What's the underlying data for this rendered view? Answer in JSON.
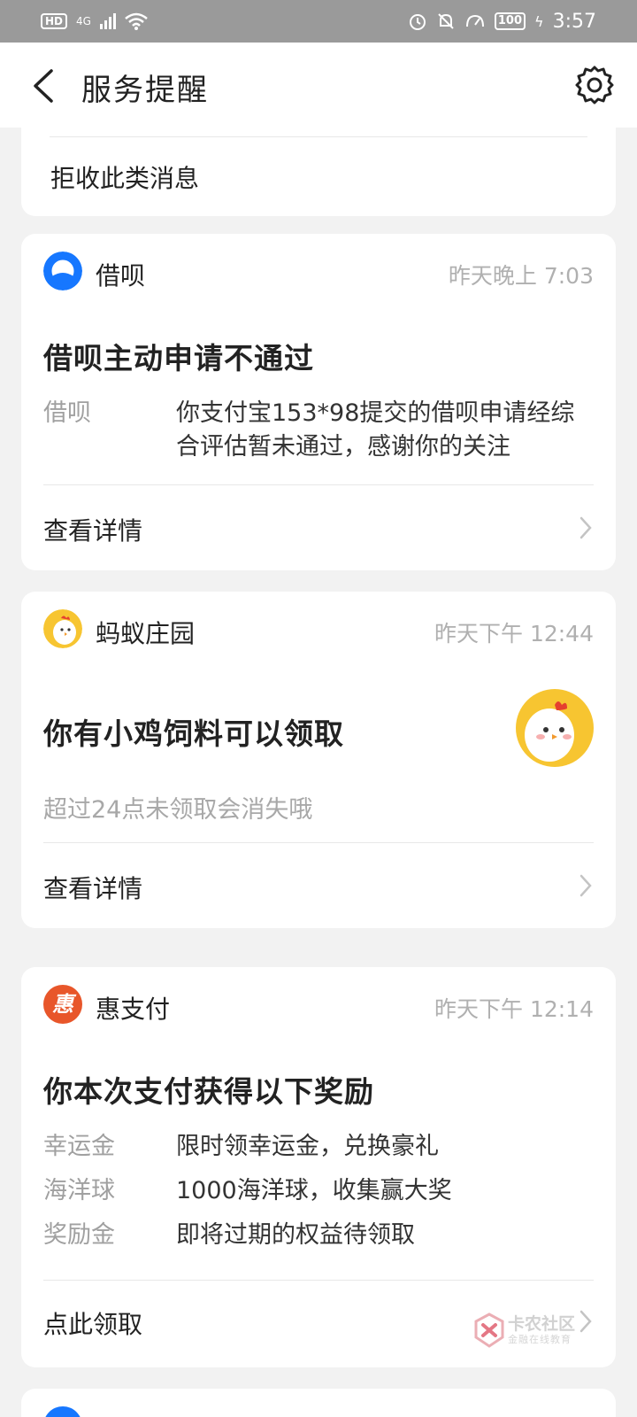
{
  "status_bar": {
    "hd_label": "HD",
    "network_label": "4G",
    "battery": "100",
    "time": "3:57"
  },
  "header": {
    "title": "服务提醒",
    "icons": {
      "back": "back-arrow-icon",
      "settings": "gear-icon"
    }
  },
  "top_card": {
    "reject_label": "拒收此类消息"
  },
  "messages": [
    {
      "app_name": "借呗",
      "icon": "jiebei-logo-icon",
      "time": "昨天晚上 7:03",
      "title": "借呗主动申请不通过",
      "rows": [
        {
          "key": "借呗",
          "value": "你支付宝153*98提交的借呗申请经综合评估暂未通过，感谢你的关注"
        }
      ],
      "action": "查看详情"
    },
    {
      "app_name": "蚂蚁庄园",
      "icon": "chicken-icon",
      "time": "昨天下午 12:44",
      "title": "你有小鸡饲料可以领取",
      "subtitle": "超过24点未领取会消失哦",
      "action": "查看详情"
    },
    {
      "app_name": "惠支付",
      "icon": "hui-logo-icon",
      "icon_text": "惠",
      "time": "昨天下午 12:14",
      "title": "你本次支付获得以下奖励",
      "rows": [
        {
          "key": "幸运金",
          "value": "限时领幸运金，兑换豪礼"
        },
        {
          "key": "海洋球",
          "value": "1000海洋球，收集赢大奖"
        },
        {
          "key": "奖励金",
          "value": "即将过期的权益待领取"
        }
      ],
      "action": "点此领取"
    }
  ],
  "watermark": {
    "title": "卡农社区",
    "subtitle": "金融在线教育"
  },
  "colors": {
    "background": "#f2f2f2",
    "status_bar": "#9a9a9a",
    "jiebei_blue": "#1677ff",
    "hui_orange": "#e8562a",
    "chick_yellow": "#f7c531",
    "muted_text": "#a0a0a0"
  }
}
